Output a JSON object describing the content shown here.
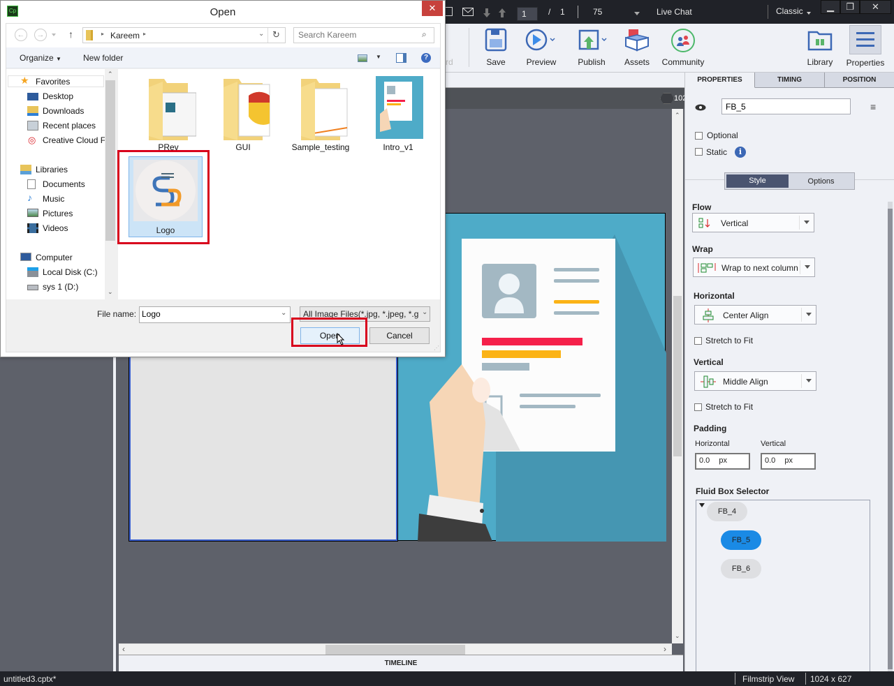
{
  "app": {
    "topbar": {
      "page_current": "1",
      "page_separator": "/",
      "page_total": "1",
      "zoom": "75",
      "live_chat": "Live Chat",
      "workspace": "Classic",
      "window_controls": [
        "minimize-icon",
        "restore-icon",
        "close-icon"
      ]
    },
    "toolbar": {
      "partial_label": "rd",
      "buttons": [
        {
          "label": "Save",
          "icon": "save-icon"
        },
        {
          "label": "Preview",
          "icon": "preview-play-icon"
        },
        {
          "label": "Publish",
          "icon": "publish-icon"
        },
        {
          "label": "Assets",
          "icon": "assets-box-icon"
        },
        {
          "label": "Community",
          "icon": "community-icon"
        },
        {
          "label": "Library",
          "icon": "library-folder-icon"
        },
        {
          "label": "Properties",
          "icon": "properties-list-icon"
        }
      ]
    },
    "ruler": {
      "readout": "102"
    },
    "timeline_label": "TIMELINE",
    "status": {
      "filename": "untitled3.cptx*",
      "view": "Filmstrip View",
      "resolution": "1024 x 627"
    },
    "properties_panel": {
      "tabs": [
        "PROPERTIES",
        "TIMING",
        "POSITION"
      ],
      "active_tab": "PROPERTIES",
      "name_value": "FB_5",
      "optional_label": "Optional",
      "optional_checked": false,
      "static_label": "Static",
      "static_checked": false,
      "subtabs": [
        "Style",
        "Options"
      ],
      "active_subtab": "Style",
      "flow": {
        "title": "Flow",
        "value": "Vertical"
      },
      "wrap": {
        "title": "Wrap",
        "value": "Wrap to next column"
      },
      "horizontal": {
        "title": "Horizontal",
        "value": "Center Align",
        "stretch_label": "Stretch to Fit",
        "stretch_checked": false
      },
      "vertical": {
        "title": "Vertical",
        "value": "Middle Align",
        "stretch_label": "Stretch to Fit",
        "stretch_checked": false
      },
      "padding": {
        "title": "Padding",
        "horizontal_label": "Horizontal",
        "horizontal_value": "0.0",
        "vertical_label": "Vertical",
        "vertical_value": "0.0",
        "unit": "px"
      },
      "fluid_box_selector": {
        "title": "Fluid Box Selector",
        "items": [
          {
            "label": "FB_4",
            "selected": false
          },
          {
            "label": "FB_5",
            "selected": true
          },
          {
            "label": "FB_6",
            "selected": false
          }
        ]
      }
    }
  },
  "dialog": {
    "title": "Open",
    "address": {
      "crumb": "Kareem",
      "search_placeholder": "Search Kareem"
    },
    "command_bar": {
      "organize": "Organize",
      "new_folder": "New folder"
    },
    "nav": {
      "favorites": {
        "label": "Favorites",
        "items": [
          "Desktop",
          "Downloads",
          "Recent places",
          "Creative Cloud Fi"
        ]
      },
      "libraries": {
        "label": "Libraries",
        "items": [
          "Documents",
          "Music",
          "Pictures",
          "Videos"
        ]
      },
      "computer": {
        "label": "Computer",
        "items": [
          "Local Disk (C:)",
          "sys 1 (D:)"
        ]
      }
    },
    "files": [
      {
        "name": "PRev",
        "type": "folder"
      },
      {
        "name": "GUI",
        "type": "folder"
      },
      {
        "name": "Sample_testing",
        "type": "folder"
      },
      {
        "name": "Intro_v1",
        "type": "image"
      },
      {
        "name": "Logo",
        "type": "image",
        "selected": true
      }
    ],
    "filename_label": "File name:",
    "filename_value": "Logo",
    "filter": "All Image Files(*.jpg, *.jpeg, *.g",
    "open_label": "Open",
    "cancel_label": "Cancel"
  },
  "colors": {
    "highlight_red": "#d8001c",
    "selection_blue": "#1a8ae5",
    "topbar_dark": "#202228",
    "stage_gray": "#5e616a"
  }
}
